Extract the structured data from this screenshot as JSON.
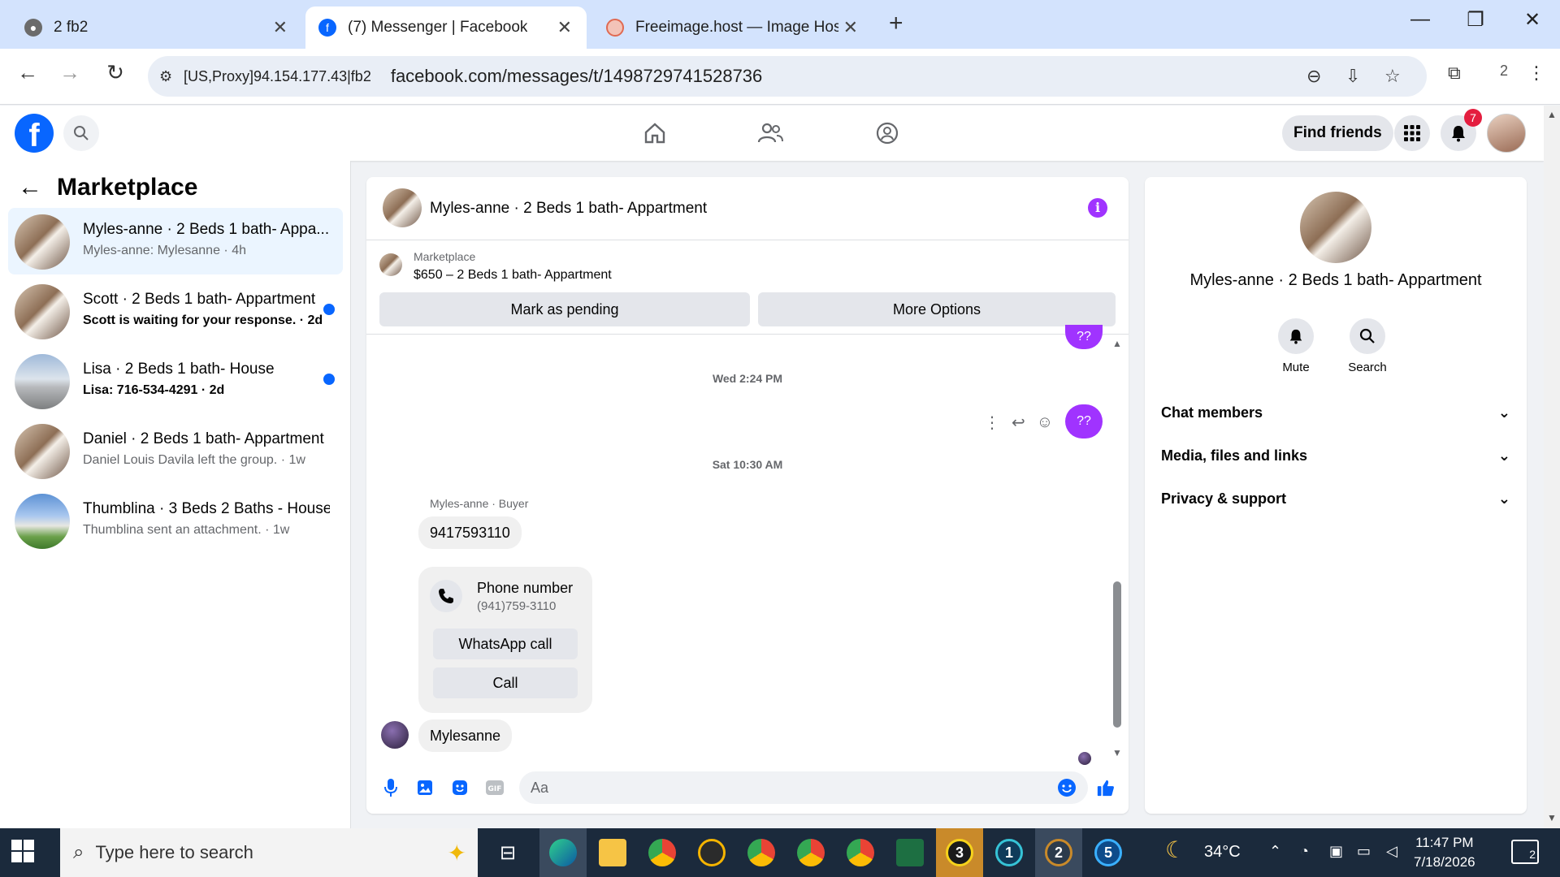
{
  "browser": {
    "tabs": [
      {
        "label": "2 fb2"
      },
      {
        "label": "(7) Messenger | Facebook"
      },
      {
        "label": "Freeimage.host — Image Hostin"
      }
    ],
    "proxy_label": "[US,Proxy]94.154.177.43|fb2",
    "url": "facebook.com/messages/t/1498729741528736",
    "profile_count": "2"
  },
  "fb_header": {
    "find_friends": "Find friends",
    "notification_count": "7"
  },
  "sidebar": {
    "title": "Marketplace",
    "conversations": [
      {
        "name": "Myles-anne · 2 Beds 1 bath- Appa...",
        "preview": "Myles-anne: Mylesanne · 4h",
        "unread": false
      },
      {
        "name": "Scott · 2 Beds 1 bath- Appartment",
        "preview": "Scott is waiting for your response. · 2d",
        "unread": true
      },
      {
        "name": "Lisa · 2 Beds 1 bath- House",
        "preview": "Lisa: 716-534-4291 · 2d",
        "unread": true
      },
      {
        "name": "Daniel · 2 Beds 1 bath- Appartment",
        "preview": "Daniel Louis Davila left the group. · 1w",
        "unread": false
      },
      {
        "name": "Thumblina · 3 Beds 2 Baths - House",
        "preview": "Thumblina sent an attachment. · 1w",
        "unread": false
      }
    ]
  },
  "chat": {
    "title": "Myles-anne · 2 Beds 1 bath- Appartment",
    "listing": {
      "label": "Marketplace",
      "item": "$650 – 2 Beds 1 bath- Appartment",
      "mark_pending": "Mark as pending",
      "more_options": "More Options"
    },
    "messages": {
      "my_bubble_top": "??",
      "ts1": "Wed 2:24 PM",
      "my_bubble": "??",
      "ts2": "Sat 10:30 AM",
      "sender_label": "Myles-anne · Buyer",
      "phone_msg": "9417593110",
      "contact_title": "Phone number",
      "contact_number": "(941)759-3110",
      "whatsapp_call": "WhatsApp call",
      "call": "Call",
      "last_msg": "Mylesanne"
    },
    "composer_placeholder": "Aa"
  },
  "right_panel": {
    "name": "Myles-anne · 2 Beds 1 bath- Appartment",
    "mute": "Mute",
    "search": "Search",
    "sections": [
      "Chat members",
      "Media, files and links",
      "Privacy & support"
    ]
  },
  "taskbar": {
    "search_placeholder": "Type here to search",
    "temperature": "34°C",
    "time": "11:47 PM",
    "date": "7/18/2026",
    "notif_count": "2",
    "app_badges": [
      "3",
      "1",
      "2",
      "5"
    ]
  }
}
